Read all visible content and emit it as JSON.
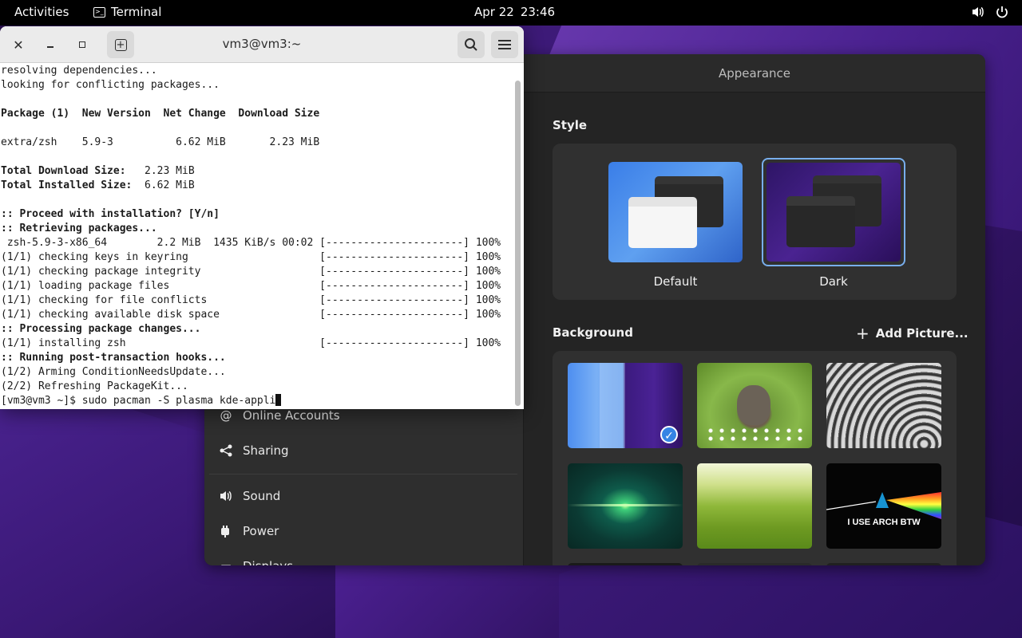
{
  "topbar": {
    "activities": "Activities",
    "app_name": "Terminal",
    "date": "Apr 22",
    "time": "23:46",
    "icons": [
      "volume-icon",
      "power-icon"
    ]
  },
  "terminal": {
    "title": "vm3@vm3:~",
    "lines": [
      {
        "text": "resolving dependencies...",
        "bold": false
      },
      {
        "text": "looking for conflicting packages...",
        "bold": false
      },
      {
        "text": "",
        "bold": false
      },
      {
        "text": "Package (1)  New Version  Net Change  Download Size",
        "bold": true
      },
      {
        "text": "",
        "bold": false
      },
      {
        "text": "extra/zsh    5.9-3          6.62 MiB       2.23 MiB",
        "bold": false
      },
      {
        "text": "",
        "bold": false
      },
      {
        "text": "Total Download Size:   2.23 MiB",
        "bold": "label"
      },
      {
        "text": "Total Installed Size:  6.62 MiB",
        "bold": "label"
      },
      {
        "text": "",
        "bold": false
      },
      {
        "text": ":: Proceed with installation? [Y/n]",
        "bold": true
      },
      {
        "text": ":: Retrieving packages...",
        "bold": true
      },
      {
        "text": " zsh-5.9-3-x86_64        2.2 MiB  1435 KiB/s 00:02 [----------------------] 100%",
        "bold": false
      },
      {
        "text": "(1/1) checking keys in keyring                     [----------------------] 100%",
        "bold": false
      },
      {
        "text": "(1/1) checking package integrity                   [----------------------] 100%",
        "bold": false
      },
      {
        "text": "(1/1) loading package files                        [----------------------] 100%",
        "bold": false
      },
      {
        "text": "(1/1) checking for file conflicts                  [----------------------] 100%",
        "bold": false
      },
      {
        "text": "(1/1) checking available disk space                [----------------------] 100%",
        "bold": false
      },
      {
        "text": ":: Processing package changes...",
        "bold": true
      },
      {
        "text": "(1/1) installing zsh                               [----------------------] 100%",
        "bold": false
      },
      {
        "text": ":: Running post-transaction hooks...",
        "bold": true
      },
      {
        "text": "(1/2) Arming ConditionNeedsUpdate...",
        "bold": false
      },
      {
        "text": "(2/2) Refreshing PackageKit...",
        "bold": false
      }
    ],
    "prompt": "[vm3@vm3 ~]$ sudo pacman -S plasma kde-appli"
  },
  "settings": {
    "header_title": "Appearance",
    "style_label": "Style",
    "style_options": [
      {
        "label": "Default",
        "selected": false
      },
      {
        "label": "Dark",
        "selected": true
      }
    ],
    "background_label": "Background",
    "add_picture": "Add Picture...",
    "sidebar": {
      "items": [
        {
          "label": "Online Accounts",
          "icon": "at-icon"
        },
        {
          "label": "Sharing",
          "icon": "share-icon"
        },
        {
          "label": "Sound",
          "icon": "speaker-icon"
        },
        {
          "label": "Power",
          "icon": "power-plug-icon"
        },
        {
          "label": "Displays",
          "icon": "display-icon"
        }
      ]
    },
    "wallpapers": [
      {
        "name": "adwaita-default",
        "selected": true
      },
      {
        "name": "kitten-in-grass",
        "selected": false
      },
      {
        "name": "grey-spiral",
        "selected": false
      },
      {
        "name": "green-light-burst",
        "selected": false
      },
      {
        "name": "green-hills",
        "selected": false
      },
      {
        "name": "arch-prism",
        "selected": false,
        "caption": "I USE ARCH BTW"
      }
    ]
  },
  "colors": {
    "accent": "#78aeed",
    "panel": "#242424",
    "topbar": "#000000"
  }
}
